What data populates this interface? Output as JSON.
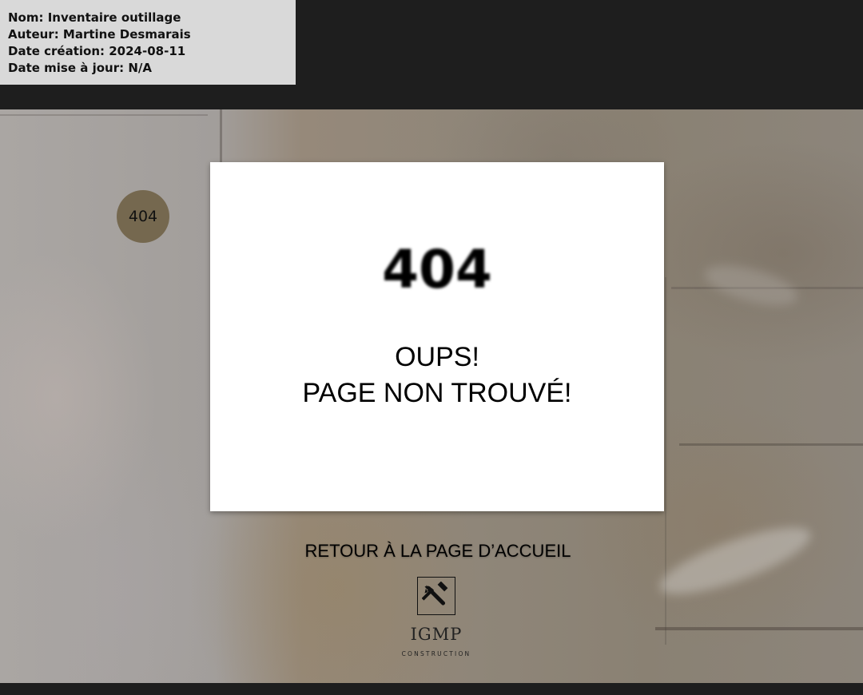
{
  "meta": {
    "name": "Nom: Inventaire outillage",
    "author": "Auteur: Martine Desmarais",
    "created": "Date création: 2024-08-11",
    "updated": "Date mise à jour: N/A"
  },
  "badge": {
    "label": "404"
  },
  "error": {
    "code": "404",
    "line1": "OUPS!",
    "line2": "PAGE NON TROUVÉ!"
  },
  "home_link": {
    "label": "RETOUR À LA PAGE D’ACCUEIL"
  },
  "logo": {
    "icon": "tools-icon",
    "name": "IGMP",
    "subtitle": "CONSTRUCTION"
  },
  "colors": {
    "background_dark": "#1e1e1e",
    "meta_box": "#d9d9d9",
    "badge": "#75684f",
    "card": "#ffffff"
  }
}
